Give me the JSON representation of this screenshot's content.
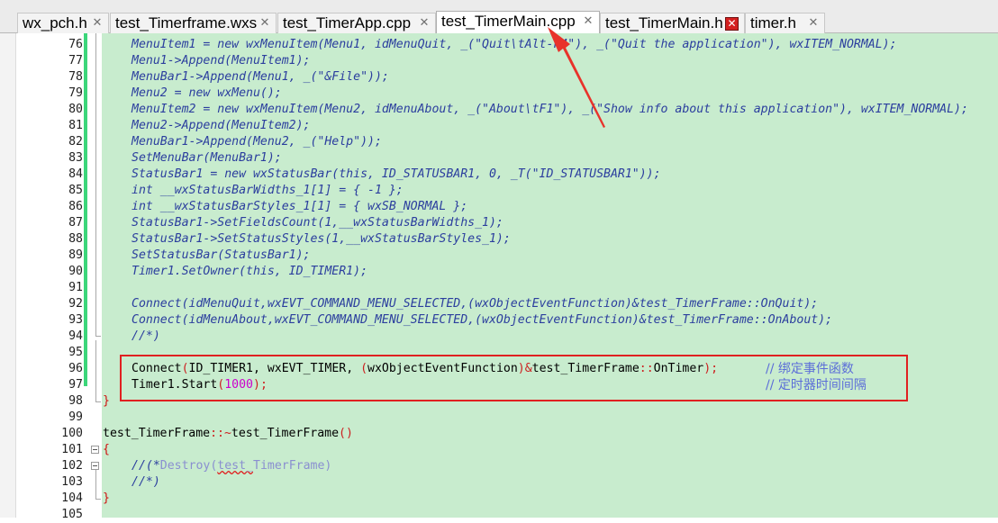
{
  "tabs": [
    {
      "label": "wx_pch.h",
      "close": "✕",
      "active": false
    },
    {
      "label": "test_Timerframe.wxs",
      "close": "✕",
      "active": false
    },
    {
      "label": "test_TimerApp.cpp",
      "close": "✕",
      "active": false
    },
    {
      "label": "test_TimerMain.cpp",
      "close": "✕",
      "active": true
    },
    {
      "label": "test_TimerMain.h",
      "close": "✕",
      "active": false
    },
    {
      "label": "timer.h",
      "close": "✕",
      "active": false
    }
  ],
  "line_numbers": [
    "76",
    "77",
    "78",
    "79",
    "80",
    "81",
    "82",
    "83",
    "84",
    "85",
    "86",
    "87",
    "88",
    "89",
    "90",
    "91",
    "92",
    "93",
    "94",
    "95",
    "96",
    "97",
    "98",
    "99",
    "100",
    "101",
    "102",
    "103",
    "104",
    "105"
  ],
  "code": {
    "l76": "MenuItem1 = new wxMenuItem(Menu1, idMenuQuit, _(\"Quit\\tAlt-F4\"), _(\"Quit the application\"), wxITEM_NORMAL);",
    "l77": "Menu1->Append(MenuItem1);",
    "l78": "MenuBar1->Append(Menu1, _(\"&File\"));",
    "l79": "Menu2 = new wxMenu();",
    "l80": "MenuItem2 = new wxMenuItem(Menu2, idMenuAbout, _(\"About\\tF1\"), _(\"Show info about this application\"), wxITEM_NORMAL);",
    "l81": "Menu2->Append(MenuItem2);",
    "l82": "MenuBar1->Append(Menu2, _(\"Help\"));",
    "l83": "SetMenuBar(MenuBar1);",
    "l84": "StatusBar1 = new wxStatusBar(this, ID_STATUSBAR1, 0, _T(\"ID_STATUSBAR1\"));",
    "l85": "int __wxStatusBarWidths_1[1] = { -1 };",
    "l86": "int __wxStatusBarStyles_1[1] = { wxSB_NORMAL };",
    "l87": "StatusBar1->SetFieldsCount(1,__wxStatusBarWidths_1);",
    "l88": "StatusBar1->SetStatusStyles(1,__wxStatusBarStyles_1);",
    "l89": "SetStatusBar(StatusBar1);",
    "l90": "Timer1.SetOwner(this, ID_TIMER1);",
    "l92": "Connect(idMenuQuit,wxEVT_COMMAND_MENU_SELECTED,(wxObjectEventFunction)&test_TimerFrame::OnQuit);",
    "l93": "Connect(idMenuAbout,wxEVT_COMMAND_MENU_SELECTED,(wxObjectEventFunction)&test_TimerFrame::OnAbout);",
    "l94": "//*)",
    "l96a": "Connect",
    "l96b": "(",
    "l96c": "ID_TIMER1, wxEVT_TIMER, ",
    "l96d": "(",
    "l96e": "wxObjectEventFunction",
    "l96f": ")&",
    "l96g": "test_TimerFrame",
    "l96h": "::",
    "l96i": "OnTimer",
    "l96j": ");",
    "l96_comment": "// 绑定事件函数",
    "l97a": "Timer1.Start",
    "l97b": "(",
    "l97c": "1000",
    "l97d": ");",
    "l97_comment": "// 定时器时间间隔",
    "l98": "}",
    "l100a": "test_TimerFrame",
    "l100b": "::~",
    "l100c": "test_TimerFrame",
    "l100d": "()",
    "l101": "{",
    "l102a": "//(*",
    "l102b": "Destroy",
    "l102c": "(",
    "l102d": "test_",
    "l102e": "TimerFrame",
    "l102f": ")",
    "l103": "//*)",
    "l104": "}"
  },
  "colors": {
    "editor_background": "#c8ecce",
    "highlight_box": "#e02020",
    "arrow": "#e8322a",
    "change_bar": "#3cd67a"
  }
}
